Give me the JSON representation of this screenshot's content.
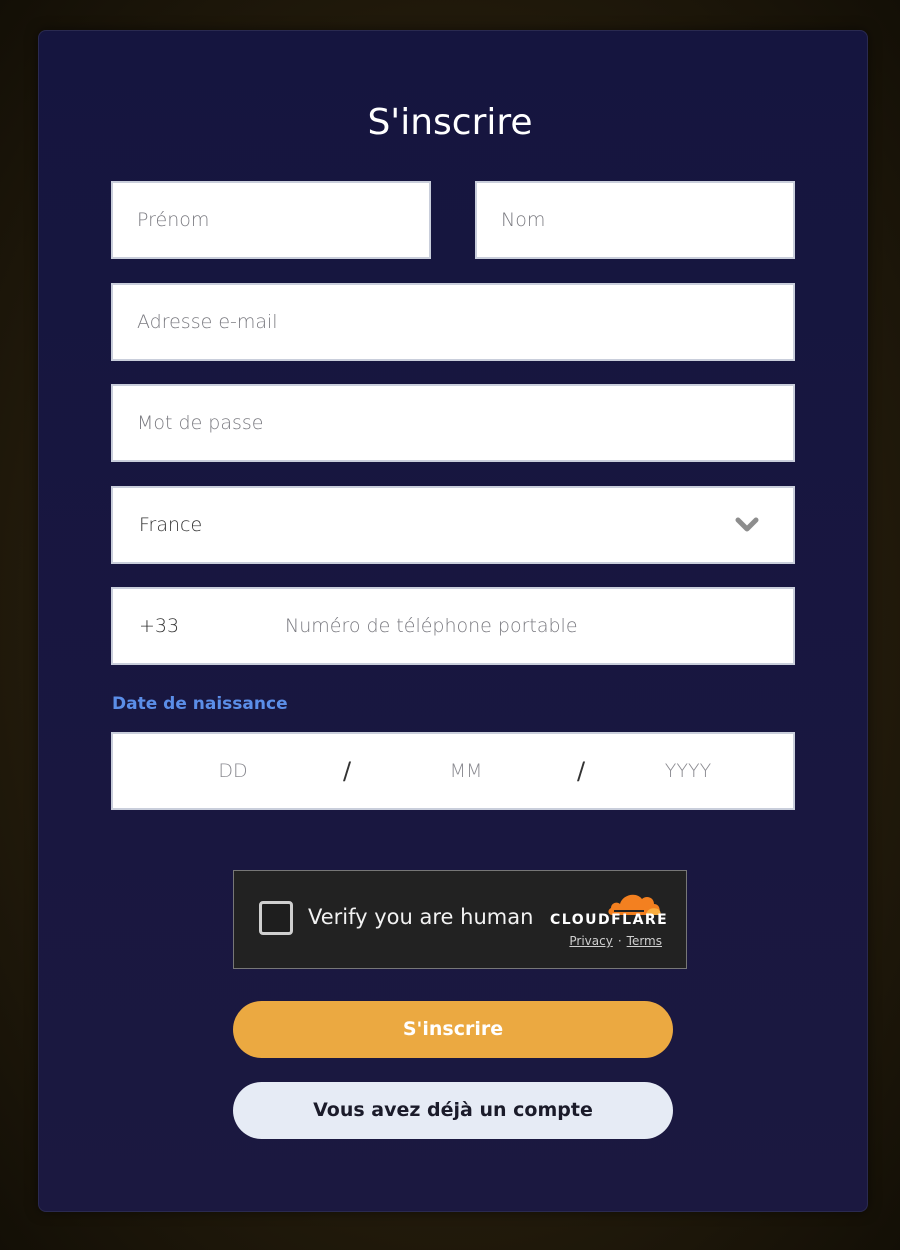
{
  "form": {
    "title": "S'inscrire",
    "first_name_placeholder": "Prénom",
    "last_name_placeholder": "Nom",
    "email_placeholder": "Adresse e-mail",
    "password_placeholder": "Mot de passe",
    "country_value": "France",
    "phone_code": "+33",
    "phone_placeholder": "Numéro de téléphone portable",
    "dob_label": "Date de naissance",
    "dob_day": "DD",
    "dob_month": "MM",
    "dob_year": "YYYY",
    "dob_separator": "/"
  },
  "captcha": {
    "label": "Verify you are human",
    "brand": "CLOUDFLARE",
    "privacy": "Privacy",
    "separator": "·",
    "terms": "Terms",
    "icon": "cloudflare-cloud-icon"
  },
  "buttons": {
    "submit": "S'inscrire",
    "login": "Vous avez déjà un compte"
  },
  "colors": {
    "card_bg": "#15153f",
    "accent_label": "#5b8ee8",
    "primary_button": "#eba941",
    "secondary_button": "#e6ebf5",
    "cloudflare_orange": "#f38020"
  },
  "icons": {
    "country_dropdown": "chevron-down-icon"
  }
}
